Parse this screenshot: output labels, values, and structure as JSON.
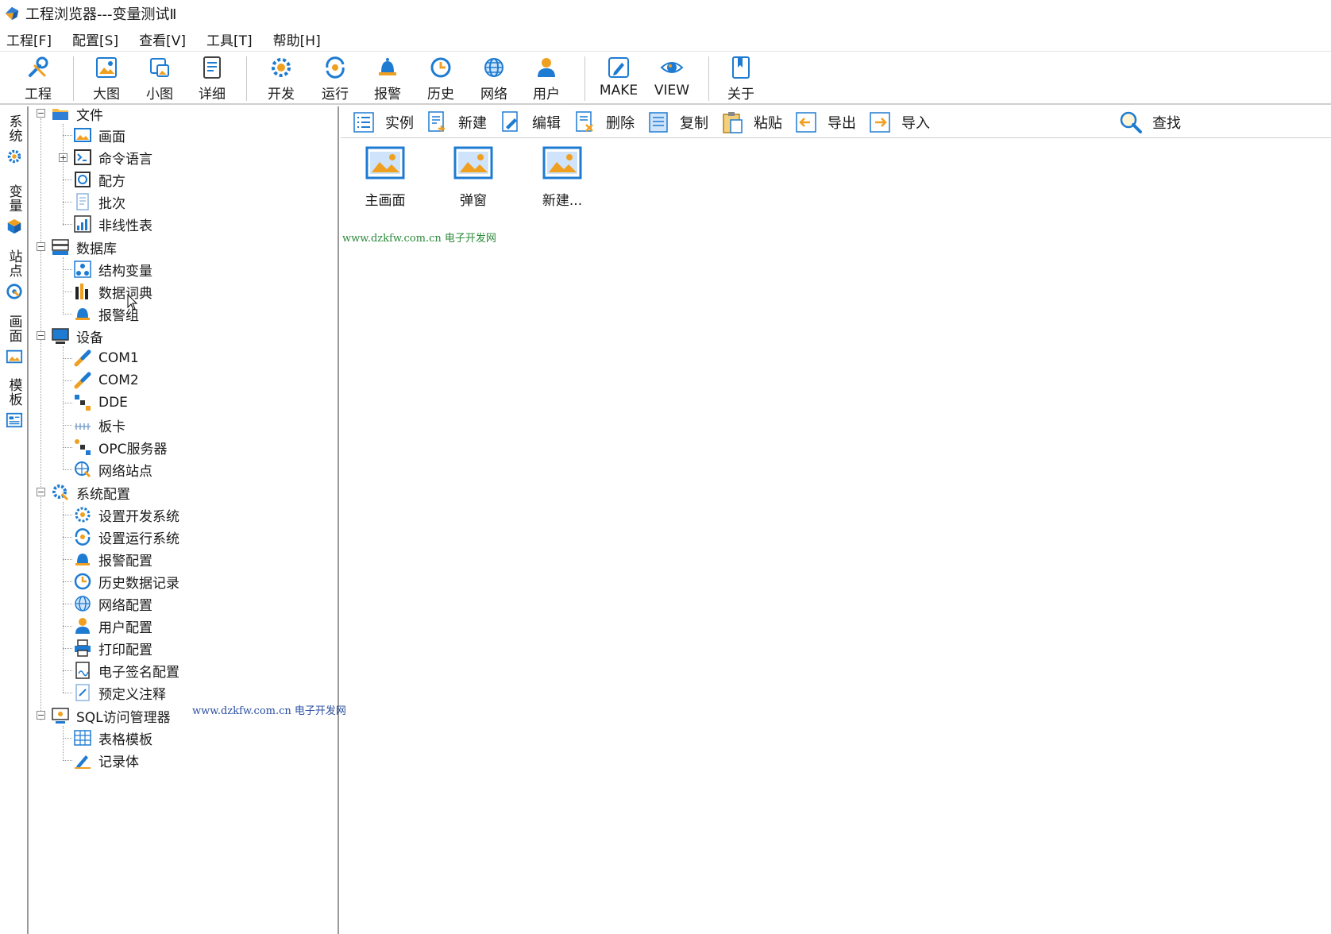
{
  "window": {
    "title": "工程浏览器---变量测试Ⅱ"
  },
  "menu": [
    "工程[F]",
    "配置[S]",
    "查看[V]",
    "工具[T]",
    "帮助[H]"
  ],
  "toolbar": {
    "project": "工程",
    "large_icons": "大图",
    "small_icons": "小图",
    "details": "详细",
    "develop": "开发",
    "run": "运行",
    "alarm": "报警",
    "history": "历史",
    "network": "网络",
    "user": "用户",
    "make": "MAKE",
    "view": "VIEW",
    "about": "关于"
  },
  "side_tabs": [
    "系统",
    "变量",
    "站点",
    "画面",
    "模板"
  ],
  "tree": {
    "file": {
      "label": "文件",
      "children": [
        "画面",
        "命令语言",
        "配方",
        "批次",
        "非线性表"
      ]
    },
    "database": {
      "label": "数据库",
      "children": [
        "结构变量",
        "数据词典",
        "报警组"
      ]
    },
    "devices": {
      "label": "设备",
      "children": [
        "COM1",
        "COM2",
        "DDE",
        "板卡",
        "OPC服务器",
        "网络站点"
      ]
    },
    "sysconfig": {
      "label": "系统配置",
      "children": [
        "设置开发系统",
        "设置运行系统",
        "报警配置",
        "历史数据记录",
        "网络配置",
        "用户配置",
        "打印配置",
        "电子签名配置",
        "预定义注释"
      ]
    },
    "sql": {
      "label": "SQL访问管理器",
      "children": [
        "表格模板",
        "记录体"
      ]
    }
  },
  "content_toolbar": {
    "instance": "实例",
    "new": "新建",
    "edit": "编辑",
    "delete": "删除",
    "copy": "复制",
    "paste": "粘贴",
    "export": "导出",
    "import": "导入",
    "find": "查找"
  },
  "screens": [
    "主画面",
    "弹窗",
    "新建..."
  ],
  "watermark": {
    "url": "www.dzkfw.com.cn",
    "name": "电子开发网"
  },
  "colors": {
    "accent_blue": "#1e7bd2",
    "alarm_orange": "#f0a020",
    "watermark_green": "#2a8a3a",
    "watermark_blue": "#2a4fa0"
  }
}
